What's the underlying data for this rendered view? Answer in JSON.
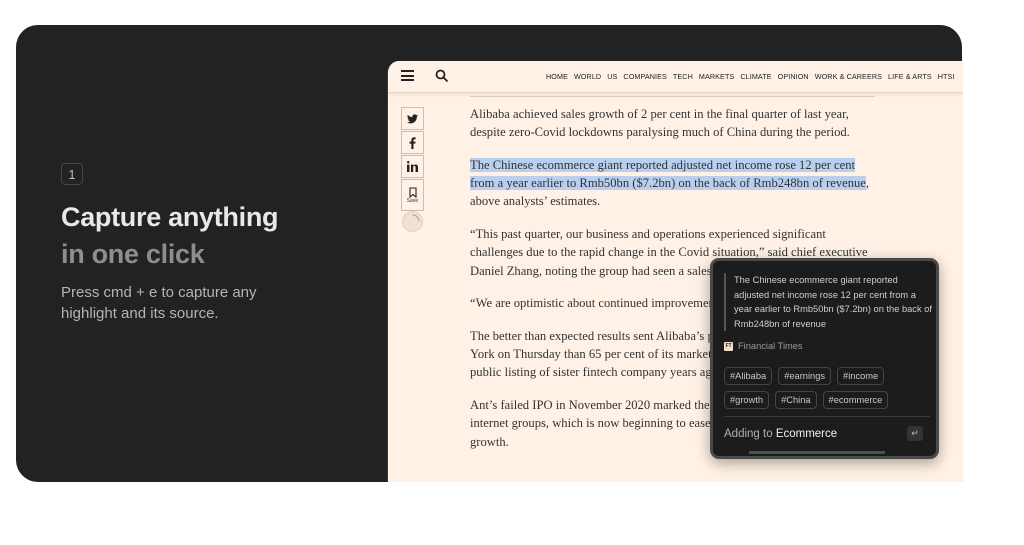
{
  "hero": {
    "step_number": "1",
    "headline_line1": "Capture anything",
    "headline_line2": "in one click",
    "description": "Press cmd + e to capture any highlight and its source."
  },
  "browser": {
    "nav_items": [
      "HOME",
      "WORLD",
      "US",
      "COMPANIES",
      "TECH",
      "MARKETS",
      "CLIMATE",
      "OPINION",
      "WORK & CAREERS",
      "LIFE & ARTS",
      "HTSI"
    ],
    "share": {
      "twitter_icon": "twitter-icon",
      "facebook_icon": "facebook-icon",
      "linkedin_icon": "linkedin-icon",
      "save_label": "Save"
    },
    "article": {
      "p1": "Alibaba achieved sales growth of 2 per cent in the final quarter of last year, despite zero-Covid lockdowns paralysing much of China during the period.",
      "p2_highlight": "The Chinese ecommerce giant reported adjusted net income rose 12 per cent from a year earlier to Rmb50bn ($7.2bn) on the back of Rmb248bn of revenue",
      "p2_rest": ", above analysts’ estimates.",
      "p3": "“This past quarter, our business and operations experienced significant challenges due to the rapid change in the Covid situation,” said chief executive Daniel Zhang, noting the group had seen a sales",
      "p4": "“We are optimistic about continued improvement",
      "p5": "The better than expected results sent Alibaba’s per cent in early trading in New York on Thursday than 65 per cent of its market value since officials planned public listing of sister fintech company years ago.",
      "p6": "Ant’s failed IPO in November 2020 marked the crackdown on China’s largest internet groups, which is now beginning to ease amid stuttering economic growth."
    }
  },
  "popup": {
    "quote": "The Chinese ecommerce giant reported adjusted net income rose 12 per cent from a year earlier to Rmb50bn ($7.2bn) on the back of Rmb248bn of revenue",
    "source_logo": "FT",
    "source_name": "Financial Times",
    "tags": [
      "#Alibaba",
      "#earnings",
      "#income",
      "#growth",
      "#China",
      "#ecommerce"
    ],
    "adding_prefix": "Adding to",
    "collection": "Ecommerce",
    "enter_key": "↵"
  },
  "colors": {
    "card_bg": "#222222",
    "page_bg": "#fff1e5",
    "highlight": "#b9cff0",
    "popup_bg": "#1c1c1c"
  }
}
